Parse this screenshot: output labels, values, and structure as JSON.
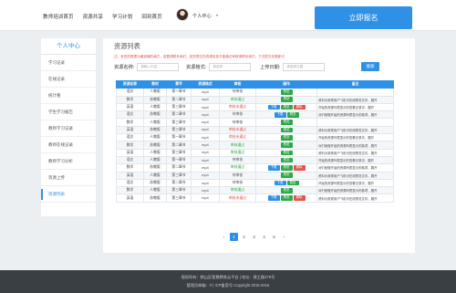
{
  "header": {
    "nav": [
      "教师培训首页",
      "资源共享",
      "学习计划",
      "回到首页"
    ],
    "user_name": "个人中心",
    "signup_label": "立即报名"
  },
  "sidebar": {
    "title": "个人中心",
    "items": [
      "学习记录",
      "在线记录",
      "统计看",
      "学生学习报告",
      "教师学习记录",
      "教师在线记录",
      "教师学习分析",
      "资源上传",
      "资源列表"
    ],
    "active_index": 8
  },
  "main": {
    "title": "资源列表",
    "notice": "注：有您的数据为最准确的格式，若要请联系我们，如您提交的资源信息不能通过审核请联系我们，下次提交查看即可"
  },
  "filter": {
    "name_label": "资源名称:",
    "name_placeholder": "请输入内容",
    "format_label": "资源格式:",
    "format_value": "请选择",
    "date_label": "上传日期:",
    "date_placeholder": "请选择日期",
    "search_label": "搜索"
  },
  "table": {
    "headers": [
      "资源名称",
      "教材",
      "章节",
      "资源格式",
      "审核",
      "操作",
      "备注"
    ],
    "rows": [
      {
        "name": "语文",
        "book": "人教版",
        "chapter": "第一章节",
        "format": "mp4",
        "status": "待审核",
        "status_type": "wait",
        "actions": [
          "pv"
        ],
        "note": ""
      },
      {
        "name": "数学",
        "book": "苏教版",
        "chapter": "第二章节",
        "format": "mp4",
        "status": "审核通过",
        "status_type": "pass",
        "actions": [
          "pv"
        ],
        "note": "资料为常规用户飞机可在线预览文件，展开"
      },
      {
        "name": "英语",
        "book": "人教版",
        "chapter": "第三章节",
        "format": "mp4",
        "status": "审核未通过",
        "status_type": "fail",
        "actions": [
          "dl",
          "pv",
          "del"
        ],
        "note": "开始的资源列表显示的查看记录次，展开"
      },
      {
        "name": "语文",
        "book": "苏教版",
        "chapter": "第二章节",
        "format": "mp4",
        "status": "待审核",
        "status_type": "wait",
        "actions": [
          "dl",
          "pv"
        ],
        "note": "对们就做开始的资源列表显示的各项，展开"
      },
      {
        "name": "数学",
        "book": "人教版",
        "chapter": "第三章节",
        "format": "mp4",
        "status": "待审核",
        "status_type": "wait",
        "actions": [
          "pv"
        ],
        "note": ""
      },
      {
        "name": "英语",
        "book": "苏教版",
        "chapter": "第三章节",
        "format": "mp4",
        "status": "审核未通过",
        "status_type": "fail",
        "actions": [
          "pv"
        ],
        "note": "资料为常规用户飞机可在线预览文件，展开"
      },
      {
        "name": "语文",
        "book": "人教版",
        "chapter": "第一章节",
        "format": "mp4",
        "status": "审核未通过",
        "status_type": "fail",
        "actions": [
          "pv"
        ],
        "note": "开始的资源列表显示的查看记录次，展开"
      },
      {
        "name": "数学",
        "book": "苏教版",
        "chapter": "第二章节",
        "format": "mp4",
        "status": "审核通过",
        "status_type": "pass",
        "actions": [
          "pv"
        ],
        "note": "对们就做开始的资源列表显示的各项，展开"
      },
      {
        "name": "英语",
        "book": "人教版",
        "chapter": "第三章节",
        "format": "mp4",
        "status": "审核通过",
        "status_type": "pass",
        "actions": [
          "pv"
        ],
        "note": "资料为常规用户飞机可在线预览文件，展开"
      },
      {
        "name": "语文",
        "book": "人教版",
        "chapter": "第一章节",
        "format": "mp4",
        "status": "待审核",
        "status_type": "wait",
        "actions": [
          "pv"
        ],
        "note": "开始的资源列表显示的查看记录次，展开"
      },
      {
        "name": "数学",
        "book": "苏教版",
        "chapter": "第二章节",
        "format": "mp4",
        "status": "审核通过",
        "status_type": "pass",
        "actions": [
          "dl",
          "pv",
          "del"
        ],
        "note": "对们就做开始的资源列表显示的各项，展开"
      },
      {
        "name": "英语",
        "book": "人教版",
        "chapter": "第三章节",
        "format": "mp4",
        "status": "待审核",
        "status_type": "wait",
        "actions": [
          "pv"
        ],
        "note": "资料为常规用户飞机可在线预览文件，展开"
      },
      {
        "name": "语文",
        "book": "苏教版",
        "chapter": "第二章节",
        "format": "mp4",
        "status": "待审核",
        "status_type": "wait",
        "actions": [
          "dl",
          "pv"
        ],
        "note": "开始的资源列表显示的查看记录次，展开"
      },
      {
        "name": "数学",
        "book": "人教版",
        "chapter": "第三章节",
        "format": "mp4",
        "status": "审核通过",
        "status_type": "pass",
        "actions": [
          "pv"
        ],
        "note": "对们就做开始的资源列表显示的各项，展开"
      },
      {
        "name": "英语",
        "book": "苏教版",
        "chapter": "第三章节",
        "format": "mp4",
        "status": "审核未通过",
        "status_type": "fail",
        "actions": [
          "dl",
          "pv",
          "del"
        ],
        "note": "资料为常规用户飞机可在线预览文件，展开"
      }
    ],
    "action_labels": {
      "dl": "下载",
      "pv": "预览",
      "del": "删除"
    }
  },
  "pagination": {
    "prev": "‹",
    "pages": [
      "1",
      "2",
      "3",
      "4",
      "5"
    ],
    "current": "1",
    "next": "›"
  },
  "footer": {
    "line1": "版权所有：鹤山区智慧教育云平台  |  地址：建工路279号",
    "line2": "管理员邮箱：#  |  ICP备案号 Copyright 2015-2016"
  },
  "colors": {
    "primary": "#2f91e6",
    "pass": "#2ea84a",
    "fail": "#e0544a",
    "footer": "#3a3f44"
  }
}
